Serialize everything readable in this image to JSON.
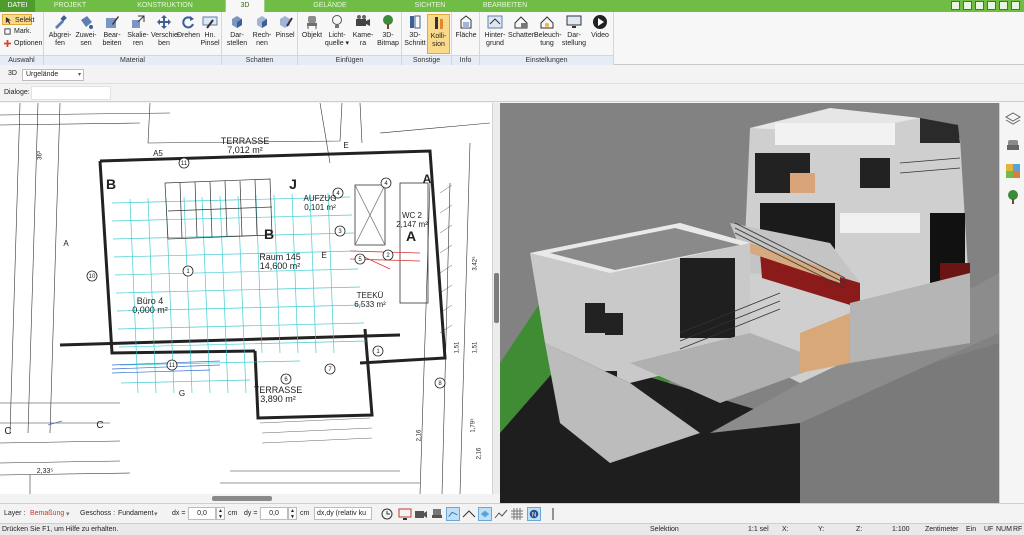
{
  "tabs": [
    "DATEI",
    "PROJEKT",
    "KONSTRUKTION",
    "3D",
    "GELÄNDE",
    "SICHTEN",
    "BEARBEITEN"
  ],
  "active_tab": "3D",
  "colors": {
    "ribbon_green": "#6fbd45",
    "active_button": "#fbd98a",
    "plan_grid": "#2fc7cf",
    "hatch_blue": "#3a6fd0"
  },
  "ribbon": {
    "auswahl": {
      "label": "Auswahl",
      "selekt": "Selekt",
      "mark": "Mark.",
      "optionen": "Optionen"
    },
    "material": {
      "label": "Material",
      "buttons": [
        "Abgrei-\nfen",
        "Zuwei-\nsen",
        "Bear-\nbeiten",
        "Skalie-\nren",
        "Verschie-\nben",
        "Drehen",
        "Hn.\nPinsel"
      ]
    },
    "schatten": {
      "label": "Schatten",
      "buttons": [
        "Dar-\nstellen",
        "Rech-\nnen",
        "Pinsel"
      ]
    },
    "einfuegen": {
      "label": "Einfügen",
      "buttons": [
        "Objekt",
        "Licht-\nquelle ▾",
        "Kame-\nra",
        "3D-\nBitmap"
      ]
    },
    "sonstige": {
      "label": "Sonstige",
      "buttons": [
        "3D-\nSchnitt",
        "Kolli-\nsion"
      ]
    },
    "info": {
      "label": "Info",
      "buttons": [
        "Fläche"
      ]
    },
    "einstellungen": {
      "label": "Einstellungen",
      "buttons": [
        "Hinter-\ngrund",
        "Schatten",
        "Beleuch-\ntung",
        "Dar-\nstellung",
        "Video"
      ]
    }
  },
  "viewbar": {
    "label": "3D",
    "layer_select": "Urgelände"
  },
  "dialogbar": {
    "label": "Dialoge:"
  },
  "plan": {
    "rooms": [
      {
        "name": "TERRASSE",
        "area": "7,012 m²"
      },
      {
        "name": "AUFZUG",
        "area": "0,101 m²"
      },
      {
        "name": "WC 2",
        "area": "2,147 m²"
      },
      {
        "name": "Raum 145",
        "area": "14,600 m²"
      },
      {
        "name": "TEEKÜ",
        "area": "6,533 m²"
      },
      {
        "name": "Büro 4",
        "area": "0,000 m²"
      },
      {
        "name": "TERRASSE",
        "area": "3,890 m²"
      }
    ],
    "axis_letters": [
      "A5",
      "A",
      "B",
      "B",
      "J",
      "A",
      "A",
      "C",
      "C",
      "G",
      "E",
      "E"
    ],
    "dimensions": [
      "36³",
      "2,33⁵",
      "1,51",
      "1,51",
      "1,79⁵",
      "2,16",
      "2,16",
      "3,42⁵"
    ]
  },
  "editbar": {
    "layer_label": "Layer :",
    "layer_value": "Bemaßung",
    "geschoss_label": "Geschoss :",
    "geschoss_value": "Fundament",
    "dx_label": "dx =",
    "dx_value": "0,0",
    "dy_label": "dy =",
    "dy_value": "0,0",
    "unit": "cm",
    "mode_value": "dx,dy (relativ ku"
  },
  "status": {
    "help": "Drücken Sie F1, um Hilfe zu erhalten.",
    "mode": "Selektion",
    "selection": "1:1 sel",
    "x": "X:",
    "y": "Y:",
    "z": "Z:",
    "scale": "1:100",
    "unit": "Zentimeter",
    "ein": "Ein",
    "uf": "UF",
    "num": "NUM",
    "rf": "RF"
  }
}
